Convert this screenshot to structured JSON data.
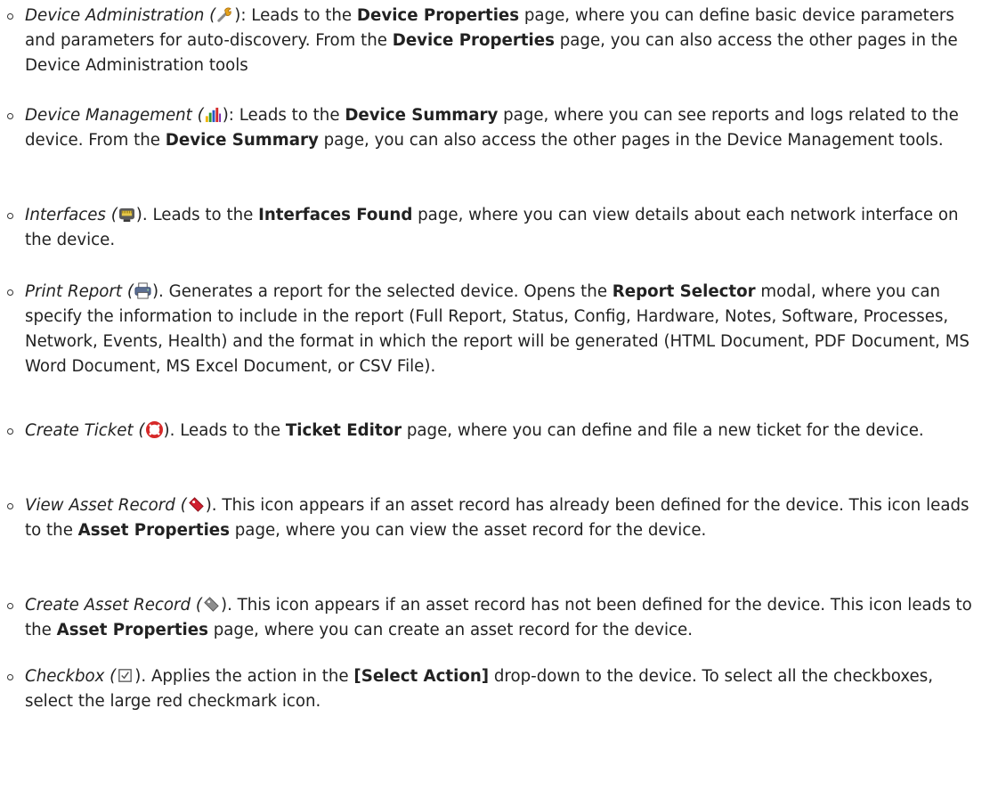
{
  "items": [
    {
      "name": "Device Administration",
      "icon": "wrench-icon",
      "a": "): Leads to the ",
      "b": "Device Properties",
      "c": " page, where you can define basic device parameters and parameters for auto-discovery. From the ",
      "d": "Device Properties",
      "e": " page, you can also access the other pages in the Device Administration tools"
    },
    {
      "name": "Device Management",
      "icon": "bar-chart-icon",
      "a": "): Leads to the ",
      "b": "Device Summary",
      "c": " page, where you can see reports and logs related to the device. From the ",
      "d": "Device Summary",
      "e": " page, you can also access the other pages in the Device Management tools."
    },
    {
      "name": "Interfaces",
      "icon": "network-port-icon",
      "a": "). Leads to the ",
      "b": "Interfaces Found",
      "c": " page, where you can view details about each network interface on the device."
    },
    {
      "name": "Print Report",
      "icon": "printer-icon",
      "a": "). Generates a report for the selected device. Opens the ",
      "b": "Report Selector",
      "c": " modal, where you can specify the information to include in the report (Full Report, Status, Config, Hardware, Notes, Software, Processes, Network, Events, Health) and the format in which the report will be generated (HTML Document, PDF Document, MS Word Document, MS Excel Document, or CSV File)."
    },
    {
      "name": "Create Ticket",
      "icon": "life-ring-icon",
      "a": "). Leads to the ",
      "b": "Ticket Editor",
      "c": " page, where you can define and file a new ticket for the device."
    },
    {
      "name": "View Asset Record",
      "icon": "red-tag-icon",
      "a": "). This icon appears if an asset record has already been defined for the device. This icon leads to the ",
      "b": "Asset Properties",
      "c": " page, where you can view the asset record for the device."
    },
    {
      "name": "Create Asset Record",
      "icon": "gray-tag-icon",
      "a": "). This icon appears if an asset record has not been defined for the device. This icon leads to the ",
      "b": "Asset Properties",
      "c": " page, where you can create an asset record for the device."
    },
    {
      "name": "Checkbox",
      "icon": "checkbox-icon",
      "a": "). Applies the action in the ",
      "b": "[Select Action]",
      "c": " drop-down to the device. To select all the checkboxes, select the large red checkmark icon."
    }
  ]
}
